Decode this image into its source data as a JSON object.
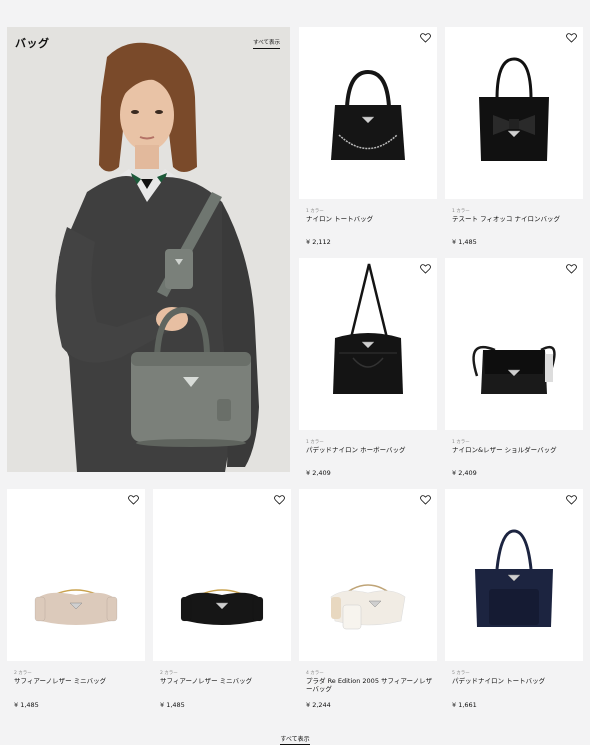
{
  "hero": {
    "title": "バッグ",
    "view_all": "すべて表示"
  },
  "products": [
    {
      "colors": "1 カラー",
      "name": "ナイロン トートバッグ",
      "price": "¥ 2,112",
      "bag_color": "#151515",
      "bag": "tote-chain"
    },
    {
      "colors": "1 カラー",
      "name": "テスート フィオッコ ナイロンバッグ",
      "price": "¥ 1,485",
      "bag_color": "#111111",
      "bag": "bow-tote"
    },
    {
      "colors": "1 カラー",
      "name": "パデッドナイロン ホーボーバッグ",
      "price": "¥ 2,409",
      "bag_color": "#141414",
      "bag": "hobo"
    },
    {
      "colors": "1 カラー",
      "name": "ナイロン&レザー ショルダーバッグ",
      "price": "¥ 2,409",
      "bag_color": "#1a1a1a",
      "bag": "shoulder"
    },
    {
      "colors": "2 カラー",
      "name": "サフィアーノレザー ミニバッグ",
      "price": "¥ 1,485",
      "bag_color": "#dccabb",
      "bag": "mini"
    },
    {
      "colors": "2 カラー",
      "name": "サフィアーノレザー ミニバッグ",
      "price": "¥ 1,485",
      "bag_color": "#161616",
      "bag": "mini"
    },
    {
      "colors": "4 カラー",
      "name": "プラダ Re Edition 2005 サフィアーノレザーバッグ",
      "price": "¥ 2,244",
      "bag_color": "#f1ece4",
      "bag": "re-edition"
    },
    {
      "colors": "5 カラー",
      "name": "パデッドナイロン トートバッグ",
      "price": "¥ 1,661",
      "bag_color": "#1c2440",
      "bag": "navy-tote"
    }
  ],
  "footer": {
    "view_all": "すべて表示"
  }
}
